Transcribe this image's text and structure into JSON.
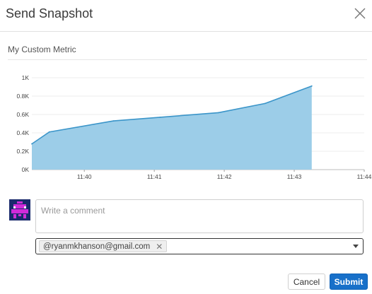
{
  "dialog": {
    "title": "Send Snapshot",
    "close_icon": "close-icon"
  },
  "metric": {
    "title": "My Custom Metric"
  },
  "chart_data": {
    "type": "area",
    "title": "My Custom Metric",
    "xlabel": "",
    "ylabel": "",
    "ylim": [
      0,
      1000
    ],
    "xlim": [
      "11:39:15",
      "11:44"
    ],
    "x_ticks": [
      "11:40",
      "11:41",
      "11:42",
      "11:43",
      "11:44"
    ],
    "y_ticks": [
      "0K",
      "0.2K",
      "0.4K",
      "0.6K",
      "0.8K",
      "1K"
    ],
    "grid": true,
    "series": [
      {
        "x": [
          "11:39:15",
          "11:39:30",
          "11:40:25",
          "11:41:05",
          "11:41:55",
          "11:42:35",
          "11:43:15"
        ],
        "values": [
          280,
          410,
          530,
          570,
          620,
          720,
          910
        ],
        "color": "#7ec3e6",
        "line_color": "#2f90c8"
      }
    ]
  },
  "comment": {
    "placeholder": "Write a comment",
    "value": ""
  },
  "recipients": {
    "chips": [
      "@ryanmkhanson@gmail.com"
    ]
  },
  "buttons": {
    "cancel": "Cancel",
    "submit": "Submit"
  },
  "colors": {
    "accent": "#1870c9",
    "area_fill": "#9ccde8",
    "area_line": "#3b95c9"
  }
}
